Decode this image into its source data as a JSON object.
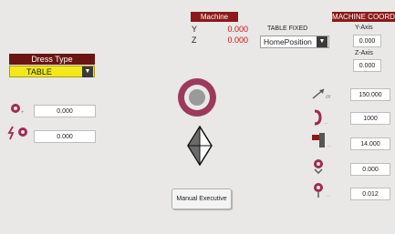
{
  "machine_panel": {
    "header": "Machine",
    "y_label": "Y",
    "y_value": "0.000",
    "z_label": "Z",
    "z_value": "0.000"
  },
  "table_fixed": {
    "label": "TABLE FIXED",
    "selected": "HomePosition",
    "arrow": "▼"
  },
  "machine_coord": {
    "header": "MACHINE COORD",
    "y_axis_label": "Y-Axis",
    "y_axis_value": "0.000",
    "z_axis_label": "Z-Axis",
    "z_axis_value": "0.000"
  },
  "dress_type": {
    "header": "Dress Type",
    "selected": "TABLE",
    "arrow": "▼",
    "highlight_color": "#f2e81a"
  },
  "left_fields": {
    "field1_value": "0.000",
    "field2_value": "0.000"
  },
  "right_params": [
    {
      "icon": "feed-rate-icon",
      "value": "150.000"
    },
    {
      "icon": "wheel-speed-icon",
      "value": "1000"
    },
    {
      "icon": "dresser-tool-icon",
      "value": "14.000"
    },
    {
      "icon": "dress-depth-icon",
      "value": "0.000"
    },
    {
      "icon": "dress-amount-icon",
      "value": "0.012"
    }
  ],
  "manual_button": {
    "label": "Manual Executive"
  },
  "colors": {
    "header_bg": "#8b1a1a",
    "red_value": "#d01010",
    "wheel_color": "#9b3a5c"
  }
}
